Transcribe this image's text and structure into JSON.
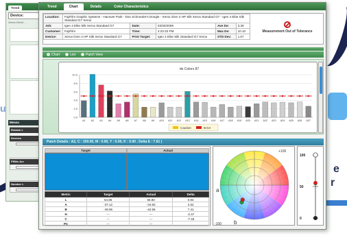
{
  "back_window": {
    "tab_label": "Trend",
    "device_label": "Device:",
    "device_value": "Xerox iGen4 ...",
    "measure_title": "Measu",
    "rows": [
      "Relatch L",
      "Devices",
      "PRMs Are",
      "Number L"
    ]
  },
  "tabs": [
    "Trend",
    "Chart",
    "Details",
    "Color Characteristics"
  ],
  "active_tab": 1,
  "info": {
    "location_label": "Location:",
    "location_value": "FujiFilm Graphic Systems - Hanover Park - Don Schroeder's Dongle - Xerox iGen 4 HP Silk Xerox Standard G7 - Igen 4 Elite Silk Standard G7 Xerox",
    "job_label": "Job:",
    "job_value": "Igen 4 Elite Silk Xerox Standard G7",
    "date_label": "Date:",
    "date_value": "03/30/2009",
    "ave_label": "Ave De:",
    "ave_value": "3.39",
    "customer_label": "Customer:",
    "customer_value": "FujiFilm",
    "time_label": "Time:",
    "time_value": "4:23:32 PM",
    "max_label": "Max De:",
    "max_value": "10.10",
    "device_label": "Device:",
    "device_value": "Xerox iGen 4 HP Silk Xerox Standard G7",
    "target_label": "Print Target:",
    "target_value": "Igen 4 Elite Silk Standard G7 Xerox",
    "std_label": "STD Dev:",
    "std_value": "1.67",
    "tolerance_text": "Measurement Out of Tolerance"
  },
  "view_options": [
    "Chart",
    "List",
    "Patch View"
  ],
  "selected_view": 0,
  "chart_data": {
    "type": "bar",
    "title": "de Colors 87",
    "ylim": [
      0,
      10
    ],
    "yticks": [
      0,
      2,
      4,
      6,
      8,
      10
    ],
    "categories": [
      "A1",
      "A2",
      "A3",
      "A4",
      "A5",
      "A6",
      "A7",
      "A8",
      "A9",
      "A10",
      "A11",
      "A12",
      "A13",
      "A14",
      "A15",
      "A16",
      "A17",
      "A18",
      "A19",
      "A20",
      "A21",
      "A22",
      "A23",
      "A24",
      "A25",
      "A26",
      "A27"
    ],
    "values": [
      3.9,
      10.1,
      7.6,
      6.2,
      3.2,
      3.6,
      5.5,
      2.4,
      2.4,
      3.4,
      2.4,
      2.4,
      6.1,
      3.6,
      3.5,
      2.4,
      3.0,
      2.4,
      2.6,
      2.5,
      3.2,
      3.6,
      3.4,
      3.5,
      3.4,
      3.6,
      2.6
    ],
    "colors": [
      "#56707c",
      "#1aa0c8",
      "#e0405c",
      "#2a2a2a",
      "#e07fb0",
      "#b0306e",
      "#d8d8a0",
      "#8e7a4e",
      "#e8e8c8",
      "#9a9a9a",
      "#c8c8c8",
      "#d0d0d0",
      "#2aa0a8",
      "#9a9a9a",
      "#c0c0c0",
      "#b8b8b8",
      "#b0b0b0",
      "#a8a8a8",
      "#c8c8c8",
      "#3a3a3a",
      "#9a9a9a",
      "#bdbdbd",
      "#c8c8c8",
      "#d0d0d0",
      "#bcbcbc",
      "#d8d8d8",
      "#8a8a8a"
    ],
    "markers": [
      5.0,
      5.0,
      5.0,
      5.0,
      5.0,
      5.0,
      5.0,
      5.0,
      5.0,
      5.0,
      5.0,
      5.0,
      5.0,
      5.0,
      5.0,
      5.0,
      5.0,
      5.0,
      5.0,
      5.0,
      5.0,
      5.0,
      5.0,
      5.0,
      5.0,
      5.0,
      5.0
    ],
    "legend": [
      {
        "name": "Caution",
        "color": "#f2c200"
      },
      {
        "name": "Error",
        "color": "#d62020"
      }
    ]
  },
  "patch_details": "Patch Details : A2, C : 100.00, M : 0.00, Y : 0.00, K : 0.00 , Delta E : 7.61 )",
  "patch": {
    "target_label": "Target",
    "actual_label": "Actual",
    "swatch_color": "#0b8fd6",
    "headers": [
      "Metric",
      "Target",
      "Actual",
      "Delta"
    ],
    "rows": [
      [
        "L",
        "54.86",
        "55.80",
        "0.94"
      ],
      [
        "A",
        "-37.12",
        "-34.50",
        "2.62"
      ],
      [
        "B",
        "-49.96",
        "-42.58",
        "7.41"
      ],
      [
        "H",
        "---",
        "---",
        "-2.47"
      ],
      [
        "C",
        "---",
        "---",
        "-7.46"
      ],
      [
        "PC",
        "---",
        "---",
        ""
      ]
    ]
  },
  "circle": {
    "plus_label": "+100",
    "minus_label": "-100",
    "a_label": "a",
    "b_label": "b"
  },
  "lightness": {
    "top_label": "100",
    "mid_label": "50",
    "bottom_label": "0",
    "target_L": 54.86,
    "actual_L": 55.8
  },
  "bg_text": {
    "line1": "e",
    "line2": "r",
    "left_glyph": "u"
  }
}
